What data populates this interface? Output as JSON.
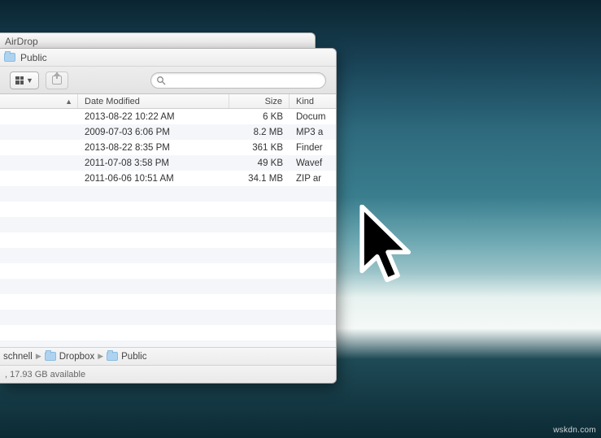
{
  "back_window": {
    "title": "AirDrop"
  },
  "window": {
    "title": "Public",
    "search_placeholder": ""
  },
  "columns": {
    "name": "",
    "date": "Date Modified",
    "size": "Size",
    "kind": "Kind"
  },
  "files": [
    {
      "date": "2013-08-22 10:22 AM",
      "size": "6 KB",
      "kind": "Docum"
    },
    {
      "date": "2009-07-03 6:06 PM",
      "size": "8.2 MB",
      "kind": "MP3 a"
    },
    {
      "date": "2013-08-22 8:35 PM",
      "size": "361 KB",
      "kind": "Finder"
    },
    {
      "date": "2011-07-08 3:58 PM",
      "size": "49 KB",
      "kind": "Wavef"
    },
    {
      "date": "2011-06-06 10:51 AM",
      "size": "34.1 MB",
      "kind": "ZIP ar"
    }
  ],
  "path": {
    "seg0": "schnell",
    "seg1": "Dropbox",
    "seg2": "Public"
  },
  "status": ", 17.93 GB available",
  "watermark": "wskdn.com"
}
